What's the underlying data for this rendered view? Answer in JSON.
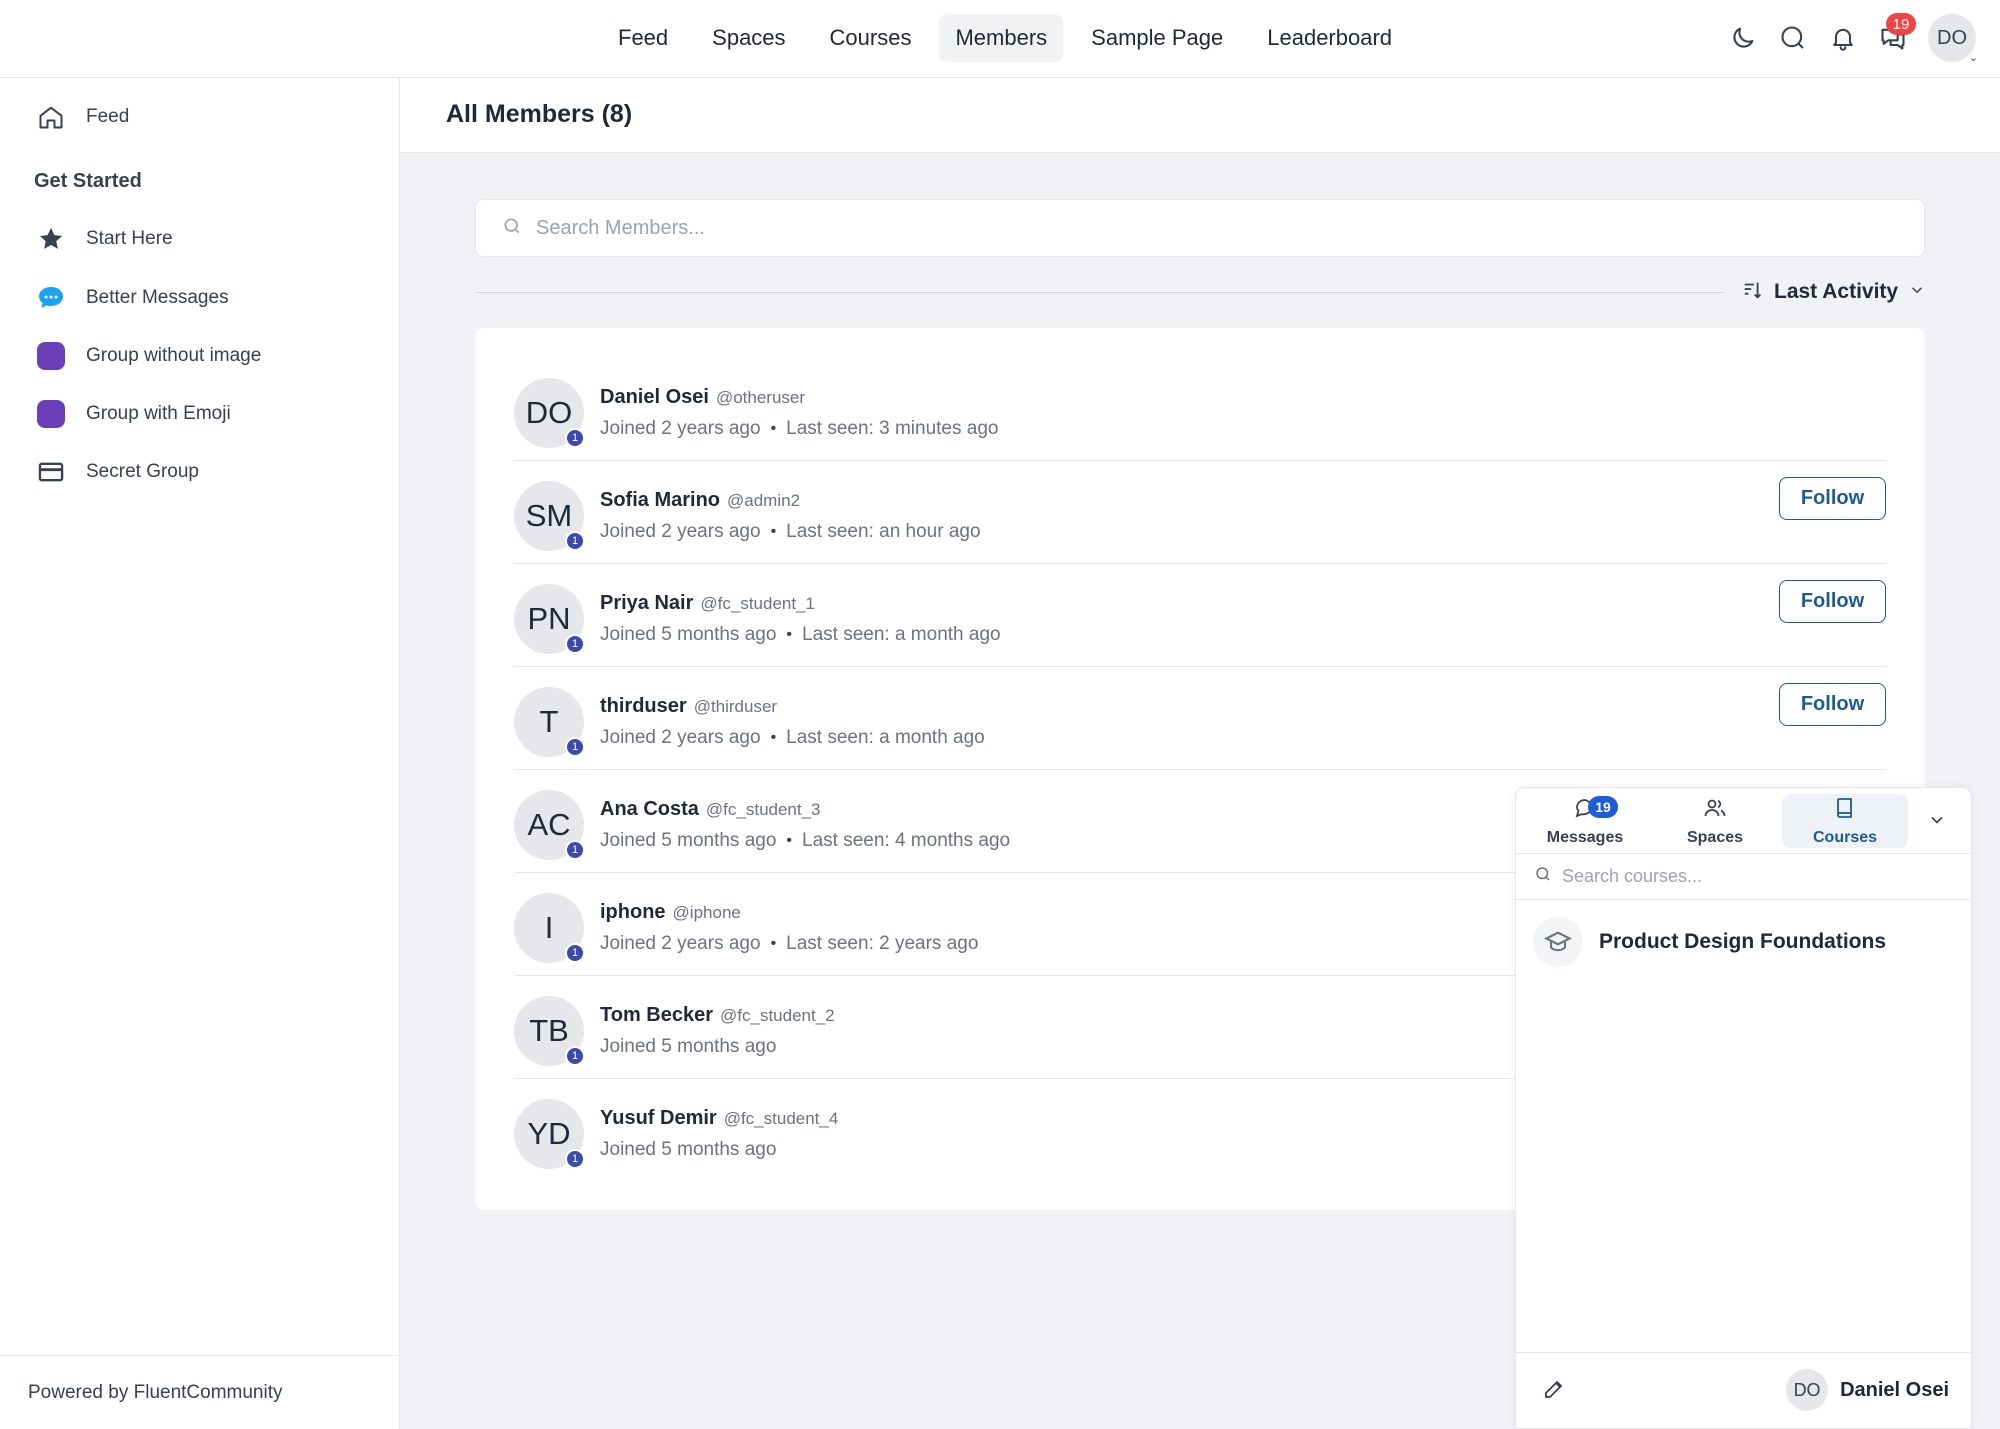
{
  "topnav": {
    "items": [
      {
        "label": "Feed",
        "active": false
      },
      {
        "label": "Spaces",
        "active": false
      },
      {
        "label": "Courses",
        "active": false
      },
      {
        "label": "Members",
        "active": true
      },
      {
        "label": "Sample Page",
        "active": false
      },
      {
        "label": "Leaderboard",
        "active": false
      }
    ],
    "messages_badge": "19",
    "user_initials": "DO"
  },
  "sidebar": {
    "feed_label": "Feed",
    "section_heading": "Get Started",
    "items": [
      {
        "label": "Start Here",
        "icon": "star-icon"
      },
      {
        "label": "Better Messages",
        "icon": "chat-bubble-icon"
      },
      {
        "label": "Group without image",
        "icon": "purple-square-icon"
      },
      {
        "label": "Group with Emoji",
        "icon": "purple-square-icon"
      },
      {
        "label": "Secret Group",
        "icon": "card-icon"
      }
    ],
    "footer": "Powered by FluentCommunity"
  },
  "main": {
    "title": "All Members (8)",
    "search_placeholder": "Search Members...",
    "sort_label": "Last Activity",
    "members": [
      {
        "initials": "DO",
        "badge": "1",
        "name": "Daniel Osei",
        "handle": "@otheruser",
        "joined": "Joined 2 years ago",
        "last_seen": "Last seen: 3 minutes ago",
        "follow": ""
      },
      {
        "initials": "SM",
        "badge": "1",
        "name": "Sofia Marino",
        "handle": "@admin2",
        "joined": "Joined 2 years ago",
        "last_seen": "Last seen: an hour ago",
        "follow": "Follow"
      },
      {
        "initials": "PN",
        "badge": "1",
        "name": "Priya Nair",
        "handle": "@fc_student_1",
        "joined": "Joined 5 months ago",
        "last_seen": "Last seen: a month ago",
        "follow": "Follow"
      },
      {
        "initials": "T",
        "badge": "1",
        "name": "thirduser",
        "handle": "@thirduser",
        "joined": "Joined 2 years ago",
        "last_seen": "Last seen: a month ago",
        "follow": "Follow"
      },
      {
        "initials": "AC",
        "badge": "1",
        "name": "Ana Costa",
        "handle": "@fc_student_3",
        "joined": "Joined 5 months ago",
        "last_seen": "Last seen: 4 months ago",
        "follow": ""
      },
      {
        "initials": "I",
        "badge": "1",
        "name": "iphone",
        "handle": "@iphone",
        "joined": "Joined 2 years ago",
        "last_seen": "Last seen: 2 years ago",
        "follow": ""
      },
      {
        "initials": "TB",
        "badge": "1",
        "name": "Tom Becker",
        "handle": "@fc_student_2",
        "joined": "Joined 5 months ago",
        "last_seen": "",
        "follow": ""
      },
      {
        "initials": "YD",
        "badge": "1",
        "name": "Yusuf Demir",
        "handle": "@fc_student_4",
        "joined": "Joined 5 months ago",
        "last_seen": "",
        "follow": ""
      }
    ]
  },
  "panel": {
    "tabs": [
      {
        "label": "Messages",
        "badge": "19",
        "active": false
      },
      {
        "label": "Spaces",
        "badge": "",
        "active": false
      },
      {
        "label": "Courses",
        "badge": "",
        "active": true
      }
    ],
    "search_placeholder": "Search courses...",
    "course_title": "Product Design Foundations",
    "user_initials": "DO",
    "user_name": "Daniel Osei"
  },
  "colors": {
    "accent": "#1e5b94",
    "badge_red": "#ef4444",
    "badge_blue": "#1d5bd8",
    "group_purple": "#6b3fb8",
    "level_badge": "#3b4ab0"
  }
}
